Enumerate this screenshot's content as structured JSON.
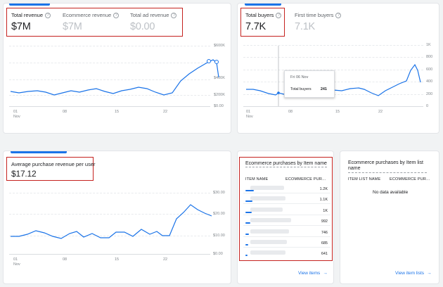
{
  "revenue_card": {
    "metrics": [
      {
        "label": "Total revenue",
        "value": "$7M"
      },
      {
        "label": "Ecommerce revenue",
        "value": "$7M"
      },
      {
        "label": "Total ad revenue",
        "value": "$0.00"
      }
    ],
    "y_ticks": [
      "$600K",
      "$400K",
      "$200K",
      "$0.00"
    ],
    "x_ticks": [
      "01",
      "08",
      "15",
      "22"
    ],
    "x_sub": "Nov"
  },
  "buyers_card": {
    "metrics": [
      {
        "label": "Total buyers",
        "value": "7.7K"
      },
      {
        "label": "First time buyers",
        "value": "7.1K"
      }
    ],
    "y_ticks": [
      "1K",
      "800",
      "600",
      "400",
      "200",
      "0"
    ],
    "x_ticks": [
      "01",
      "08",
      "15",
      "22"
    ],
    "x_sub": "Nov",
    "tooltip": {
      "date": "Fri 06 Nov",
      "label": "Total buyers",
      "value": "241"
    }
  },
  "arpu_card": {
    "metric": {
      "label": "Average purchase revenue per user",
      "value": "$17.12"
    },
    "y_ticks": [
      "$30.00",
      "$20.00",
      "$10.00",
      "$0.00"
    ],
    "x_ticks": [
      "01",
      "08",
      "15",
      "22"
    ],
    "x_sub": "Nov"
  },
  "items_card": {
    "title": "Ecommerce purchases by Item name",
    "col1": "ITEM NAME",
    "col2": "ECOMMERCE PUR...",
    "rows": [
      {
        "value": "1.2K",
        "bar": 1.0
      },
      {
        "value": "1.1K",
        "bar": 0.88
      },
      {
        "value": "1K",
        "bar": 0.7
      },
      {
        "value": "992",
        "bar": 0.58
      },
      {
        "value": "746",
        "bar": 0.45
      },
      {
        "value": "685",
        "bar": 0.3
      },
      {
        "value": "641",
        "bar": 0.15
      }
    ],
    "link": "View items"
  },
  "item_list_card": {
    "title": "Ecommerce purchases by Item list name",
    "col1": "ITEM LIST NAME",
    "col2": "ECOMMERCE PUR...",
    "empty": "No data available",
    "link": "View item lists"
  },
  "colors": {
    "accent": "#1a73e8",
    "highlight": "#c5221f"
  }
}
